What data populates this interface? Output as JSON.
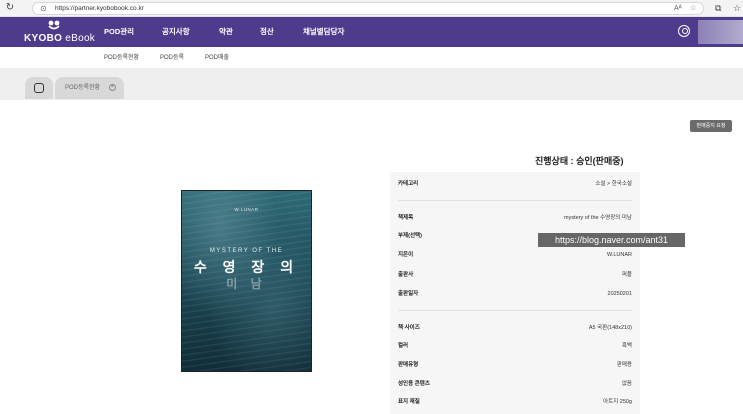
{
  "browser": {
    "url": "https://partner.kyobobook.co.kr",
    "reader_icon": "Aᴬ"
  },
  "nav": {
    "logo_bold": "KYOBO",
    "logo_light": " eBook",
    "menu": [
      "POD관리",
      "공지사항",
      "약관",
      "정산",
      "채널별담당자"
    ]
  },
  "subnav": {
    "items": [
      "POD등록현황",
      "POD등록",
      "POD매출"
    ]
  },
  "tabs": {
    "active_label": "POD등록현황"
  },
  "content": {
    "stop_sale_button": "판매중지 요청",
    "status": "진행상태 : 승인(판매중)"
  },
  "cover": {
    "author": "W.LUNAR",
    "subtitle": "MYSTERY OF THE",
    "title": "수 영 장 의",
    "title2": "미 남"
  },
  "details": {
    "category": {
      "label": "카테고리",
      "value": "소설 > 한국소설"
    },
    "title": {
      "label": "책제목",
      "value": "mystery of the 수영장의 미남"
    },
    "subtitle": {
      "label": "부제(선택)",
      "value": ""
    },
    "author": {
      "label": "지은이",
      "value": "W.LUNAR"
    },
    "publisher": {
      "label": "출판사",
      "value": "퍼플"
    },
    "pub_date": {
      "label": "출판일자",
      "value": "20250201"
    },
    "size": {
      "label": "책 사이즈",
      "value": "A5 국판(148x210)"
    },
    "color": {
      "label": "컬러",
      "value": "흑백"
    },
    "sale_type": {
      "label": "판매유형",
      "value": "판매용"
    },
    "adult": {
      "label": "성인용 콘텐츠",
      "value": "없음"
    },
    "cover_paper": {
      "label": "표지 재질",
      "value": "아트지 250g"
    }
  },
  "watermark": "https://blog.naver.com/ant31",
  "colors": {
    "brand_purple": "#4f3b8c",
    "stop_button": "#6b6b6b",
    "info_bg": "#f6f6f6"
  }
}
